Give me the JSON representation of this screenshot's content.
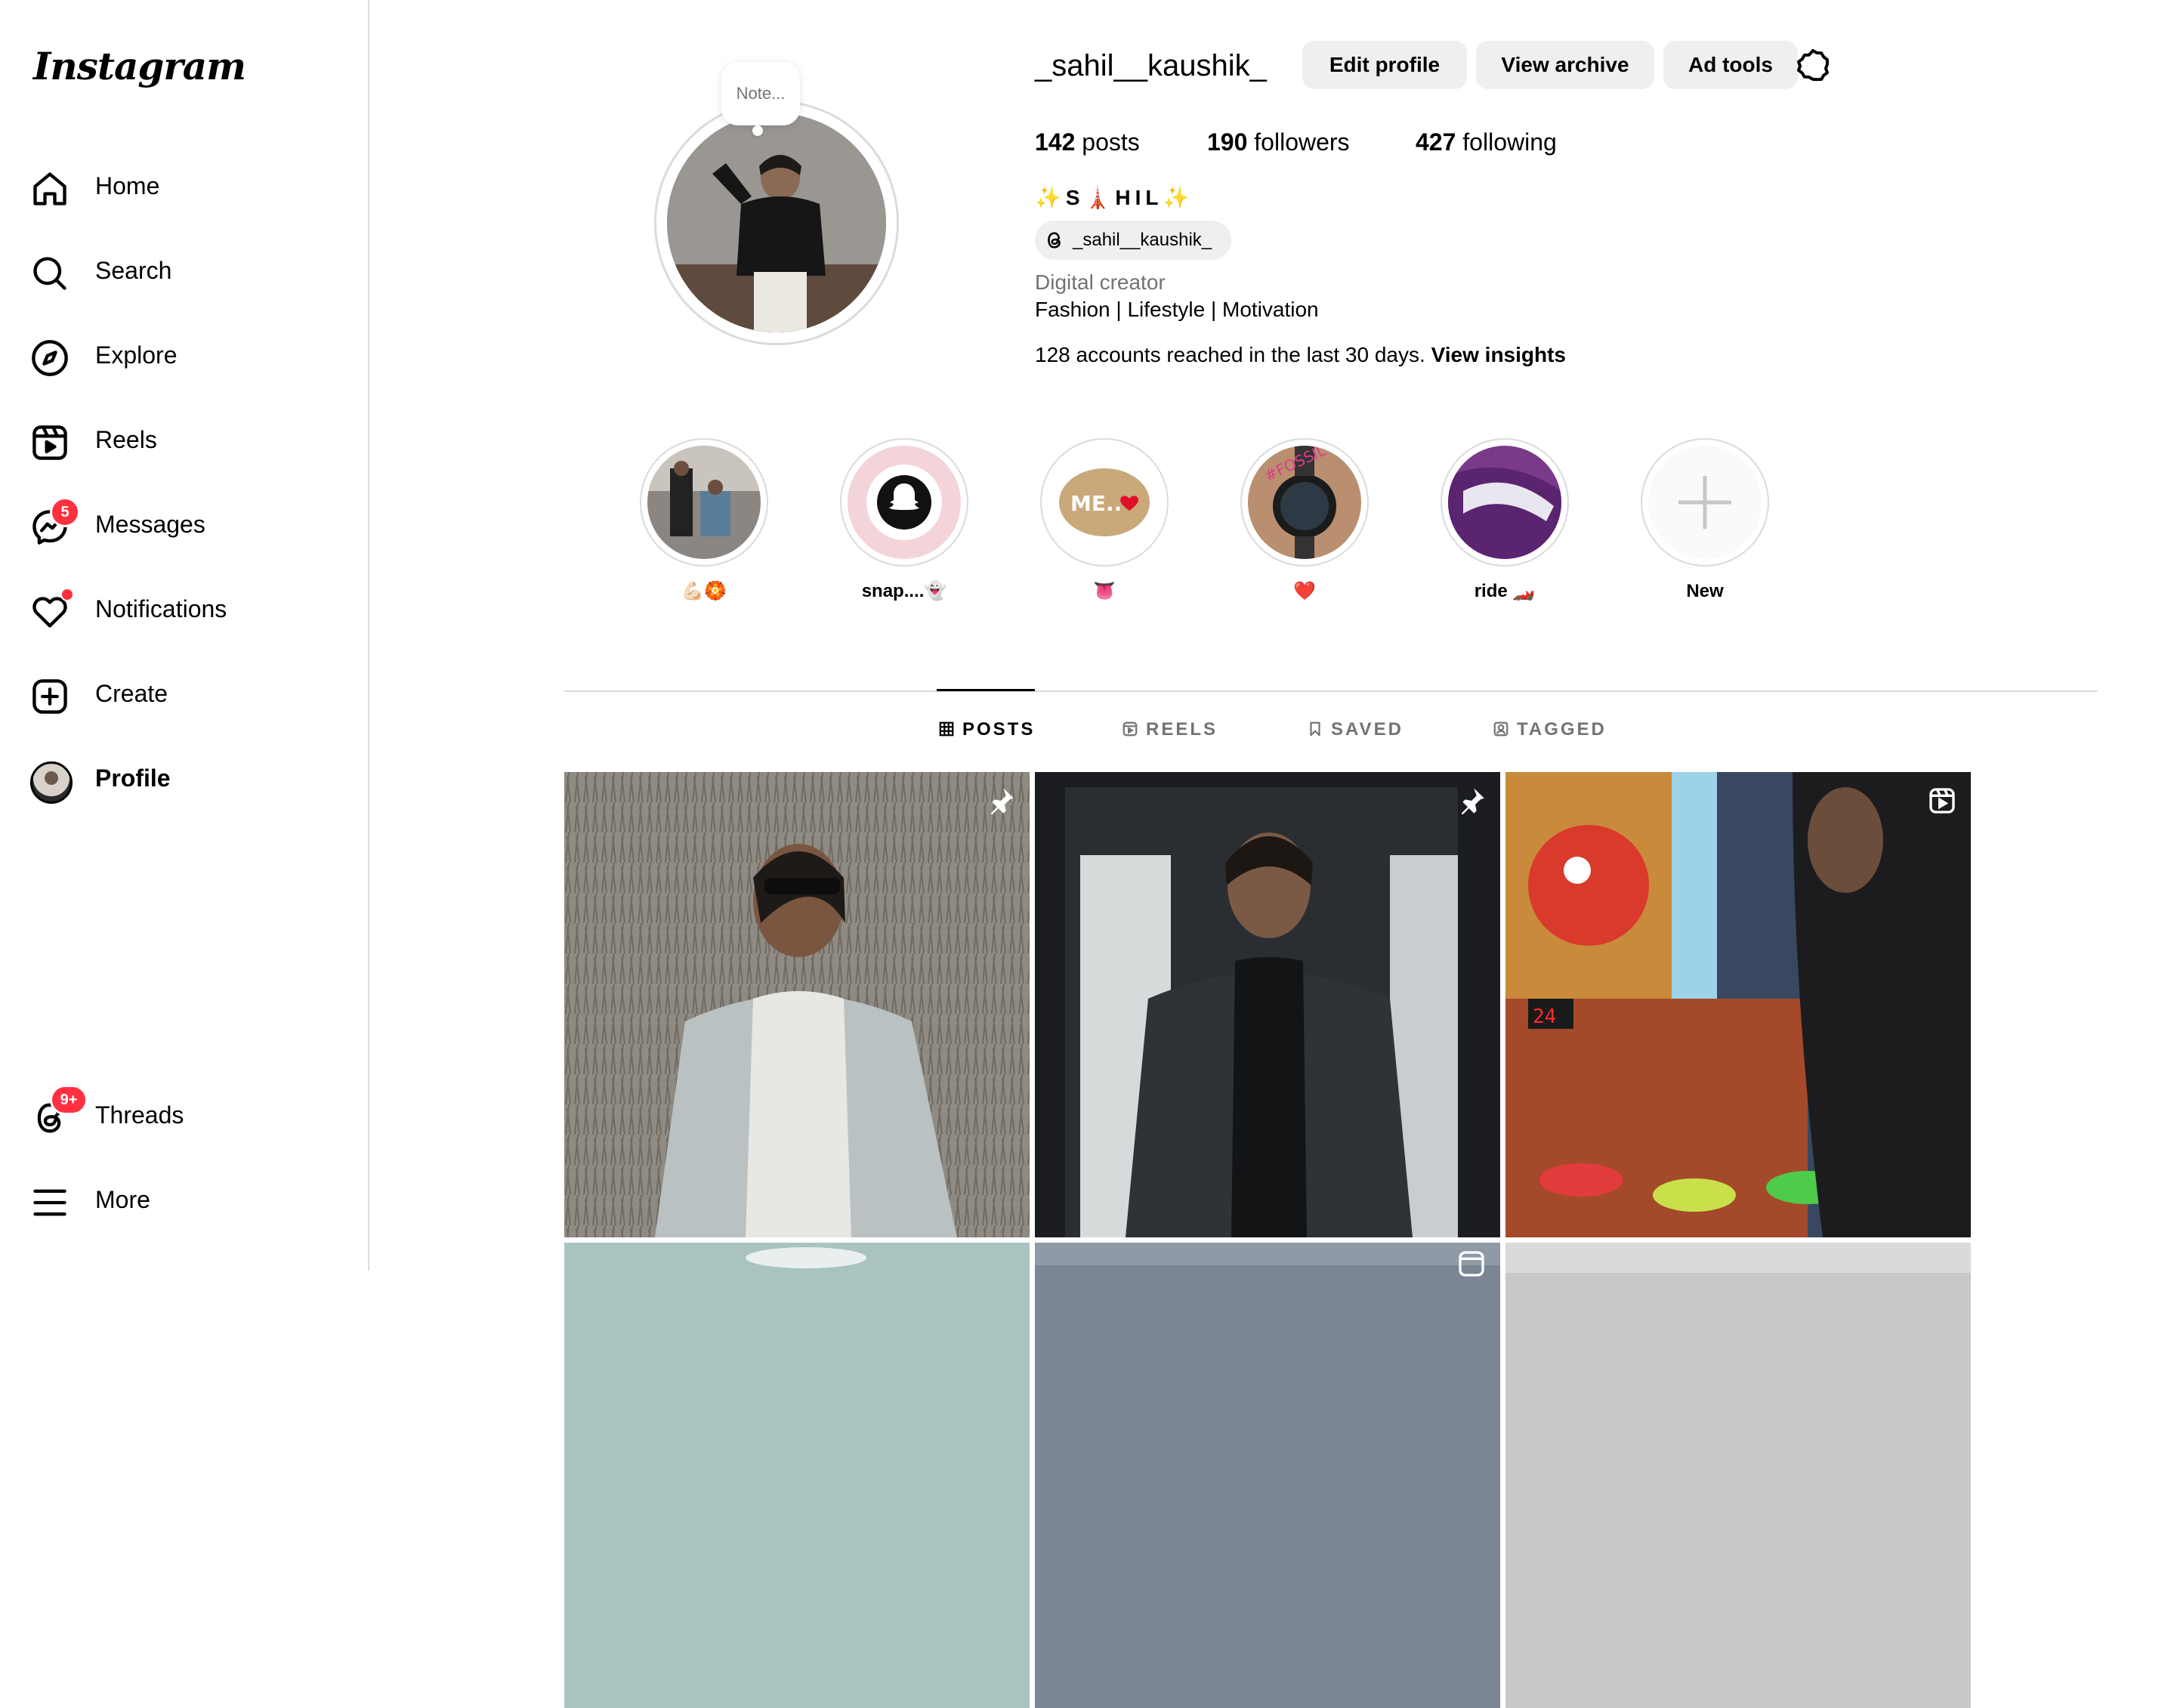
{
  "app": {
    "logo_text": "Instagram"
  },
  "sidebar": {
    "items": [
      {
        "label": "Home",
        "icon": "home-icon"
      },
      {
        "label": "Search",
        "icon": "search-icon"
      },
      {
        "label": "Explore",
        "icon": "compass-icon"
      },
      {
        "label": "Reels",
        "icon": "reels-icon"
      },
      {
        "label": "Messages",
        "icon": "messenger-icon",
        "badge": "5"
      },
      {
        "label": "Notifications",
        "icon": "heart-icon",
        "dot": true
      },
      {
        "label": "Create",
        "icon": "plus-square-icon"
      },
      {
        "label": "Profile",
        "icon": "avatar"
      }
    ],
    "bottom": [
      {
        "label": "Threads",
        "icon": "threads-icon",
        "badge": "9+"
      },
      {
        "label": "More",
        "icon": "hamburger-icon"
      }
    ]
  },
  "profile": {
    "note_placeholder": "Note...",
    "username": "_sahil__kaushik_",
    "buttons": {
      "edit": "Edit profile",
      "archive": "View archive",
      "ad_tools": "Ad tools"
    },
    "stats": {
      "posts_count": "142",
      "posts_label": "posts",
      "followers_count": "190",
      "followers_label": "followers",
      "following_count": "427",
      "following_label": "following"
    },
    "display_name": "✨S🗼HIL✨",
    "threads_handle": "_sahil__kaushik_",
    "category": "Digital creator",
    "bio": "Fashion | Lifestyle | Motivation",
    "insights_text": "128 accounts reached in the last 30 days.",
    "insights_link": "View insights"
  },
  "highlights": [
    {
      "label": "💪🏻🏵️"
    },
    {
      "label": "snap....👻"
    },
    {
      "label": "👅"
    },
    {
      "label": "❤️"
    },
    {
      "label": "ride 🏎️"
    },
    {
      "label": "New"
    }
  ],
  "tabs": [
    {
      "label": "POSTS",
      "icon": "grid-icon",
      "active": true
    },
    {
      "label": "REELS",
      "icon": "reels-icon",
      "active": false
    },
    {
      "label": "SAVED",
      "icon": "bookmark-icon",
      "active": false
    },
    {
      "label": "TAGGED",
      "icon": "tagged-icon",
      "active": false
    }
  ],
  "posts": [
    {
      "type": "pinned"
    },
    {
      "type": "pinned"
    },
    {
      "type": "reel"
    },
    {
      "type": "photo"
    },
    {
      "type": "reel"
    },
    {
      "type": "photo"
    }
  ],
  "colors": {
    "badge_red": "#ff3040",
    "button_grey": "#efefef",
    "muted_text": "#737373",
    "divider": "#dbdbdb"
  }
}
